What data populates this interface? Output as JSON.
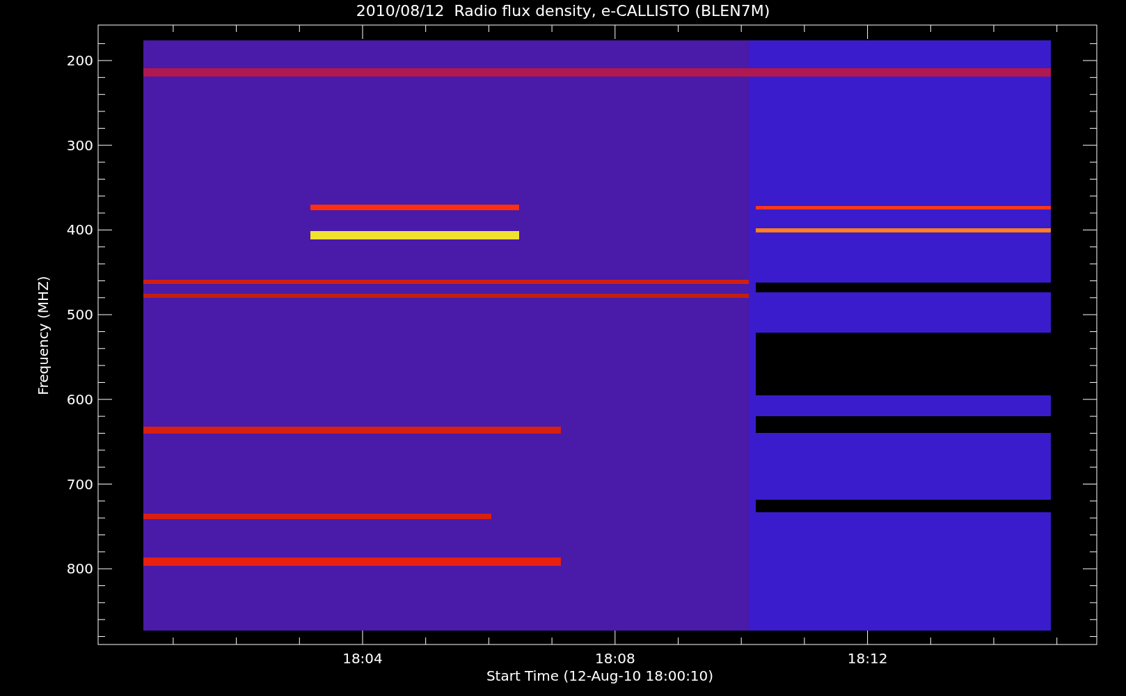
{
  "title": "2010/08/12  Radio flux density, e-CALLISTO (BLEN7M)",
  "y_axis": {
    "label": "Frequency (MHZ)",
    "ticks": [
      "200",
      "300",
      "400",
      "500",
      "600",
      "700",
      "800"
    ]
  },
  "x_axis": {
    "label": "Start Time (12-Aug-10 18:00:10)",
    "ticks": [
      "18:04",
      "18:08",
      "18:12"
    ]
  }
}
